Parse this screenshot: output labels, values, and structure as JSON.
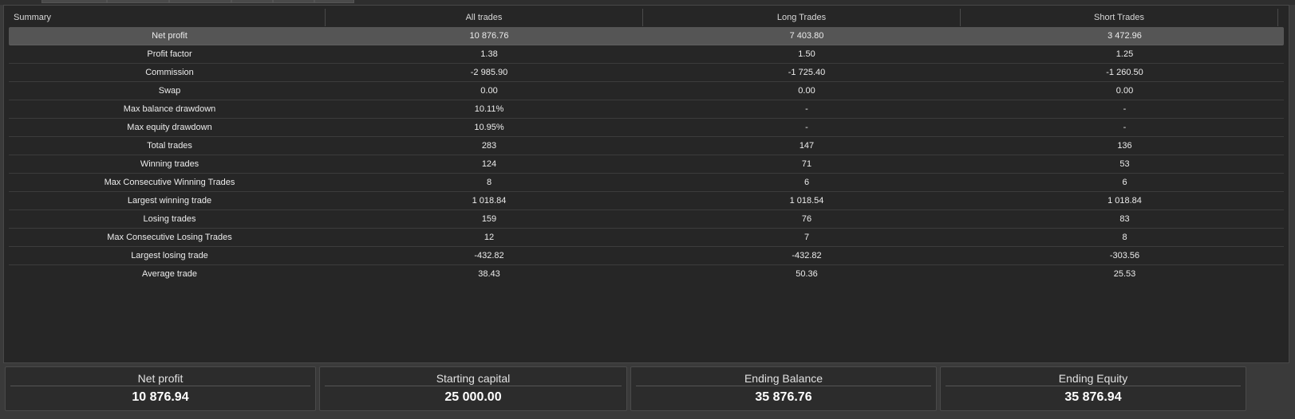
{
  "header": {
    "summary": "Summary",
    "all_trades": "All trades",
    "long_trades": "Long Trades",
    "short_trades": "Short Trades"
  },
  "rows": [
    {
      "label": "Net profit",
      "all": "10 876.76",
      "long": "7 403.80",
      "short": "3 472.96"
    },
    {
      "label": "Profit factor",
      "all": "1.38",
      "long": "1.50",
      "short": "1.25"
    },
    {
      "label": "Commission",
      "all": "-2 985.90",
      "long": "-1 725.40",
      "short": "-1 260.50"
    },
    {
      "label": "Swap",
      "all": "0.00",
      "long": "0.00",
      "short": "0.00"
    },
    {
      "label": "Max balance drawdown",
      "all": "10.11%",
      "long": "-",
      "short": "-"
    },
    {
      "label": "Max equity drawdown",
      "all": "10.95%",
      "long": "-",
      "short": "-"
    },
    {
      "label": "Total trades",
      "all": "283",
      "long": "147",
      "short": "136"
    },
    {
      "label": "Winning trades",
      "all": "124",
      "long": "71",
      "short": "53"
    },
    {
      "label": "Max Consecutive Winning Trades",
      "all": "8",
      "long": "6",
      "short": "6"
    },
    {
      "label": "Largest winning trade",
      "all": "1 018.84",
      "long": "1 018.54",
      "short": "1 018.84"
    },
    {
      "label": "Losing trades",
      "all": "159",
      "long": "76",
      "short": "83"
    },
    {
      "label": "Max Consecutive Losing Trades",
      "all": "12",
      "long": "7",
      "short": "8"
    },
    {
      "label": "Largest losing trade",
      "all": "-432.82",
      "long": "-432.82",
      "short": "-303.56"
    },
    {
      "label": "Average trade",
      "all": "38.43",
      "long": "50.36",
      "short": "25.53"
    }
  ],
  "cards": [
    {
      "title": "Net profit",
      "value": "10 876.94"
    },
    {
      "title": "Starting capital",
      "value": "25 000.00"
    },
    {
      "title": "Ending Balance",
      "value": "35 876.76"
    },
    {
      "title": "Ending Equity",
      "value": "35 876.94"
    }
  ],
  "colors": {
    "panel_bg": "#262626",
    "selected_row": "#555555",
    "outer_bg": "#3a3a3a"
  }
}
